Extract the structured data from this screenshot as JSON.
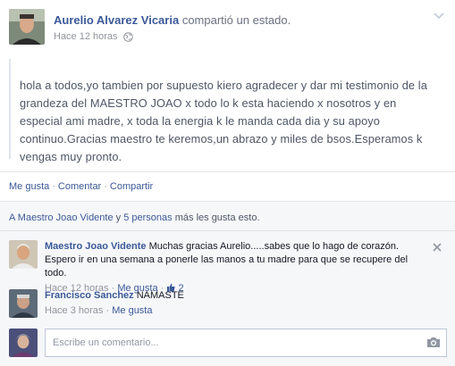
{
  "post": {
    "author_name": "Aurelio Alvarez Vicaria",
    "action_text": "compartió un",
    "action_link": "estado.",
    "timestamp": "Hace 12 horas",
    "privacy_icon": "globe-icon",
    "menu_icon": "chevron-down-icon",
    "body": "hola a todos,yo tambien por supuesto kiero agradecer y dar mi testimonio de la grandeza del MAESTRO JOAO x todo lo k esta haciendo x nosotros y en especial ami madre, x toda la energia k le manda cada dia y su apoyo continuo.Gracias maestro te keremos,un abrazo y miles de bsos.Esperamos k vengas muy pronto."
  },
  "actions": {
    "like": "Me gusta",
    "comment": "Comentar",
    "share": "Compartir",
    "separator": "·"
  },
  "likes": {
    "name": "A Maestro Joao Vidente",
    "conj": "y",
    "others": "5 personas",
    "suffix": "más les gusta esto."
  },
  "comments": [
    {
      "author": "Maestro Joao Vidente",
      "text": "Muchas gracias Aurelio.....sabes que lo hago de corazón. Espero ir en una semana a ponerle las manos a tu madre para que se recupere del todo.",
      "time": "Hace 12 horas",
      "like_label": "Me gusta",
      "like_count": "2"
    },
    {
      "author": "Francisco Sanchez",
      "text": "NAMASTE",
      "time": "Hace 3 horas",
      "like_label": "Me gusta"
    }
  ],
  "composer": {
    "placeholder": "Escribe un comentario...",
    "icon": "camera-icon"
  },
  "colors": {
    "link": "#3b5998",
    "muted": "#90949c",
    "ufi_bg": "#f6f7f9"
  }
}
